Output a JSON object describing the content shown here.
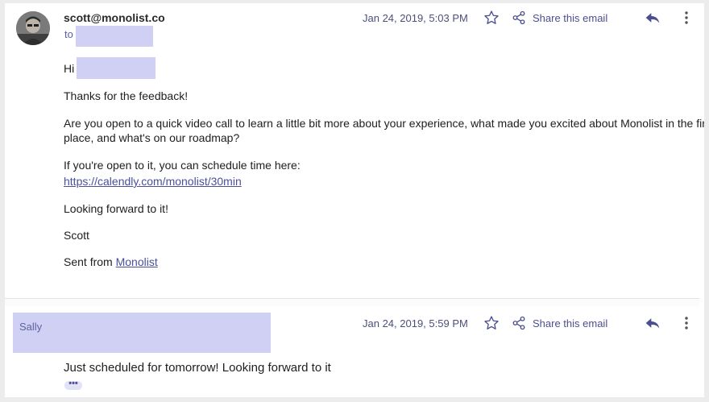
{
  "messages": [
    {
      "sender": "scott@monolist.co",
      "to_label": "to",
      "date": "Jan 24, 2019, 5:03 PM",
      "share_label": "Share this email",
      "icons": [
        "star-icon",
        "share-icon",
        "reply-icon",
        "more-vertical-icon"
      ],
      "body": {
        "greeting": "Hi",
        "line1": "Thanks for the feedback!",
        "line2a": "Are you open to a quick video call to learn a little bit more about your experience, what made you excited about Monolist in the first",
        "line2b": "place, and what's on our roadmap?",
        "line3": "If you're open to it, you can schedule time here:",
        "link": "https://calendly.com/monolist/30min",
        "line4": "Looking forward to it!",
        "signature": "Scott",
        "sent_from": "Sent from",
        "sent_from_link": "Monolist"
      }
    },
    {
      "sender": "Sally",
      "date": "Jan 24, 2019, 5:59 PM",
      "share_label": "Share this email",
      "icons": [
        "star-icon",
        "share-icon",
        "reply-icon",
        "more-vertical-icon"
      ],
      "body": {
        "text": "Just scheduled for tomorrow! Looking forward to it",
        "ellipsis": "•••"
      }
    }
  ],
  "colors": {
    "accent": "#4b4f8f",
    "redaction": "#cfd0f3",
    "date_text": "#4b4f7a"
  }
}
